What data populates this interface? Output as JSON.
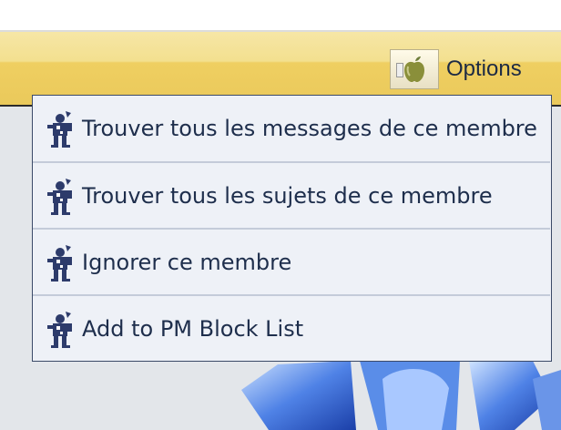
{
  "options_bar": {
    "label": "Options",
    "icon": "apple-icon"
  },
  "menu": {
    "items": [
      {
        "label": "Trouver tous les messages de ce membre",
        "icon": "member-figure-icon"
      },
      {
        "label": "Trouver tous les sujets de ce membre",
        "icon": "member-figure-icon"
      },
      {
        "label": "Ignorer ce membre",
        "icon": "member-figure-icon"
      },
      {
        "label": "Add to PM Block List",
        "icon": "member-figure-icon"
      }
    ]
  },
  "colors": {
    "bar_yellow": "#efcf61",
    "menu_bg": "#eef1f7",
    "menu_border": "#3b4a68",
    "text": "#1e2e4c"
  }
}
